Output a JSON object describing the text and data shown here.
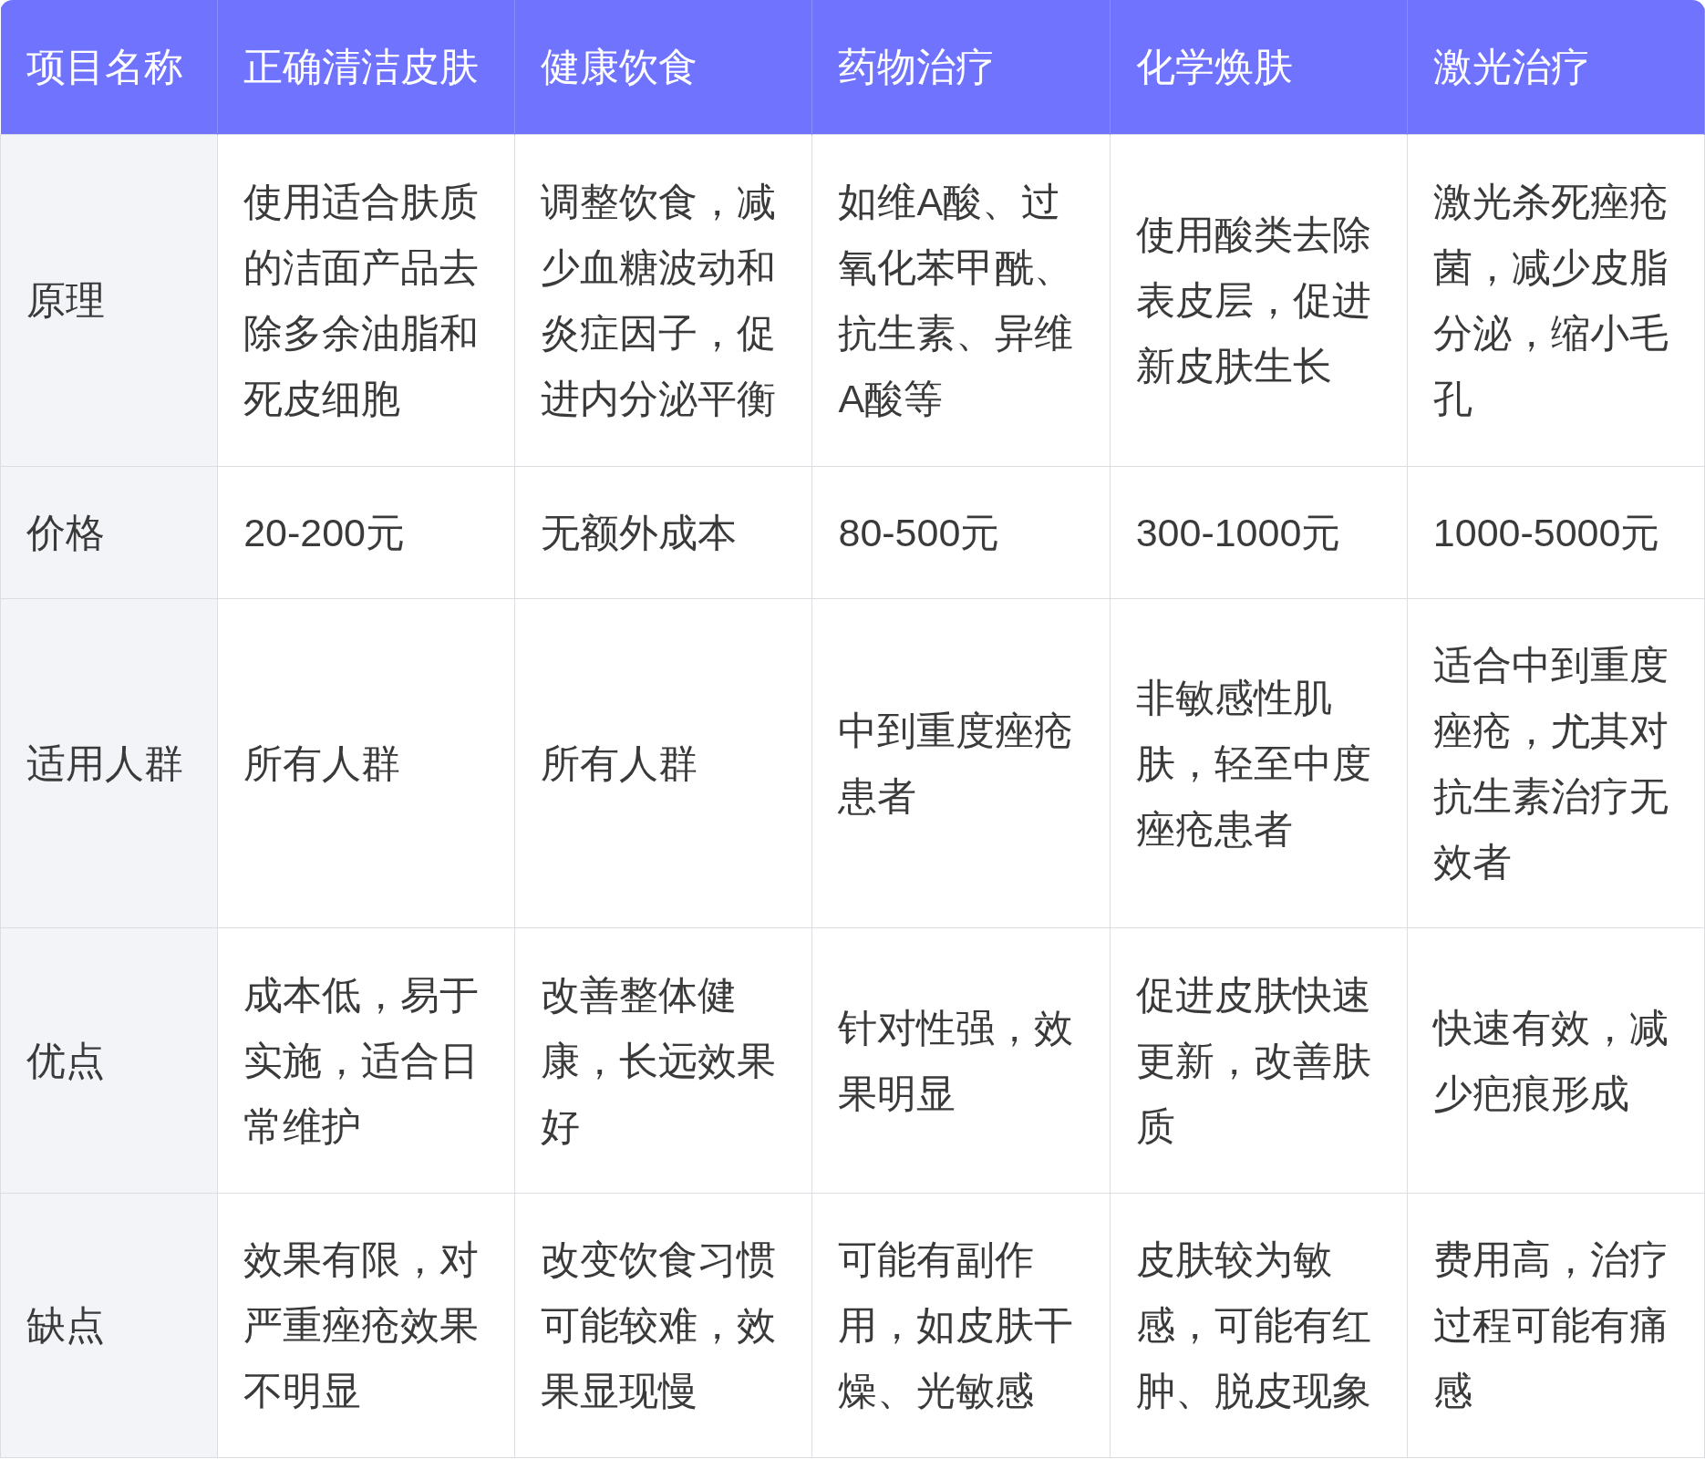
{
  "table": {
    "columns": [
      "项目名称",
      "正确清洁皮肤",
      "健康饮食",
      "药物治疗",
      "化学焕肤",
      "激光治疗"
    ],
    "rows": [
      {
        "cells": [
          "原理",
          "使用适合肤质的洁面产品去除多余油脂和死皮细胞",
          "调整饮食，减少血糖波动和炎症因子，促进内分泌平衡",
          "如维A酸、过氧化苯甲酰、抗生素、异维A酸等",
          "使用酸类去除表皮层，促进新皮肤生长",
          "激光杀死痤疮菌，减少皮脂分泌，缩小毛孔"
        ]
      },
      {
        "cells": [
          "价格",
          "20-200元",
          "无额外成本",
          "80-500元",
          "300-1000元",
          "1000-5000元"
        ]
      },
      {
        "cells": [
          "适用人群",
          "所有人群",
          "所有人群",
          "中到重度痤疮患者",
          "非敏感性肌肤，轻至中度痤疮患者",
          "适合中到重度痤疮，尤其对抗生素治疗无效者"
        ]
      },
      {
        "cells": [
          "优点",
          "成本低，易于实施，适合日常维护",
          "改善整体健康，长远效果好",
          "针对性强，效果明显",
          "促进皮肤快速更新，改善肤质",
          "快速有效，减少疤痕形成"
        ]
      },
      {
        "cells": [
          "缺点",
          "效果有限，对严重痤疮效果不明显",
          "改变饮食习惯可能较难，效果显现慢",
          "可能有副作用，如皮肤干燥、光敏感",
          "皮肤较为敏感，可能有红肿、脱皮现象",
          "费用高，治疗过程可能有痛感"
        ]
      }
    ]
  }
}
